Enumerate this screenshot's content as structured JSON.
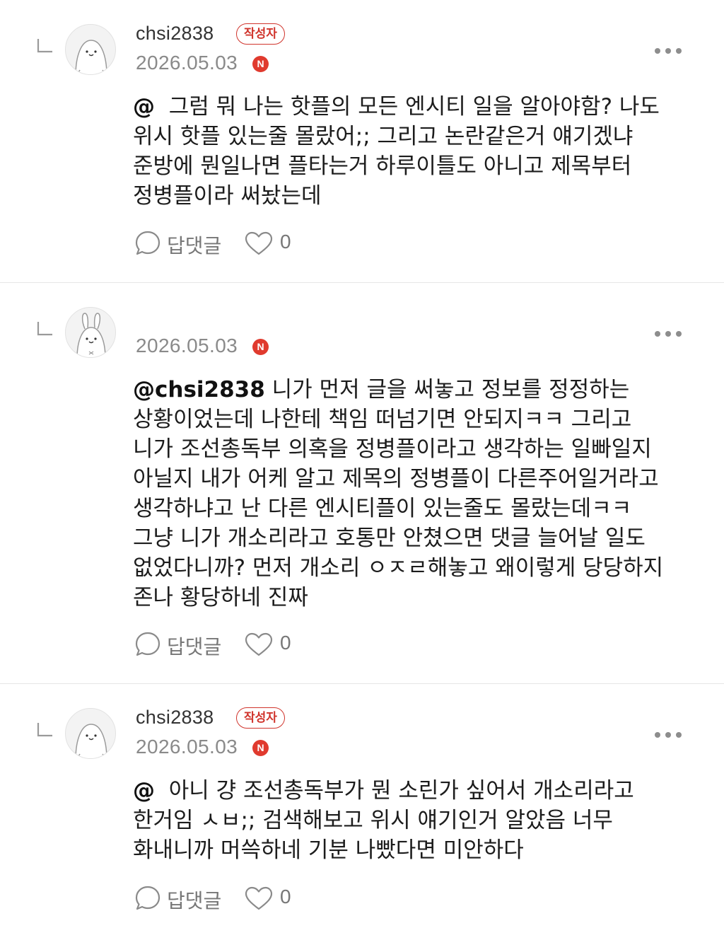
{
  "comments": [
    {
      "username": "chsi2838",
      "author_badge": "작성자",
      "date": "2026.05.03",
      "new_badge": "N",
      "mention": "@",
      "text": "  그럼 뭐 나는 핫플의 모든 엔시티 일을 알아야함? 나도\n위시 핫플 있는줄 몰랐어;; 그리고 논란같은거 얘기겠냐\n준방에 뭔일나면 플타는거 하루이틀도 아니고 제목부터\n정병플이라 써놨는데",
      "reply_label": "답댓글",
      "like_count": "0",
      "avatar_icon": "blob-character-icon"
    },
    {
      "username": "",
      "author_badge": "",
      "date": "2026.05.03",
      "new_badge": "N",
      "mention": "@chsi2838",
      "text": " 니가 먼저 글을 써놓고 정보를 정정하는\n상황이었는데 나한테 책임 떠넘기면 안되지ㅋㅋ 그리고\n니가 조선총독부 의혹을 정병플이라고 생각하는 일빠일지\n아닐지 내가 어케 알고 제목의 정병플이 다른주어일거라고\n생각하냐고 난 다른 엔시티플이 있는줄도 몰랐는데ㅋㅋ\n그냥 니가 개소리라고 호통만 안쳤으면 댓글 늘어날 일도\n없었다니까? 먼저 개소리 ㅇㅈㄹ해놓고 왜이렇게 당당하지\n존나 황당하네 진짜",
      "reply_label": "답댓글",
      "like_count": "0",
      "avatar_icon": "bunny-character-icon"
    },
    {
      "username": "chsi2838",
      "author_badge": "작성자",
      "date": "2026.05.03",
      "new_badge": "N",
      "mention": "@",
      "text": "  아니 걍 조선총독부가 뭔 소린가 싶어서 개소리라고\n한거임 ㅅㅂ;; 검색해보고 위시 얘기인거 알았음 너무\n화내니까 머쓱하네 기분 나빴다면 미안하다",
      "reply_label": "답댓글",
      "like_count": "0",
      "avatar_icon": "blob-character-icon"
    }
  ]
}
